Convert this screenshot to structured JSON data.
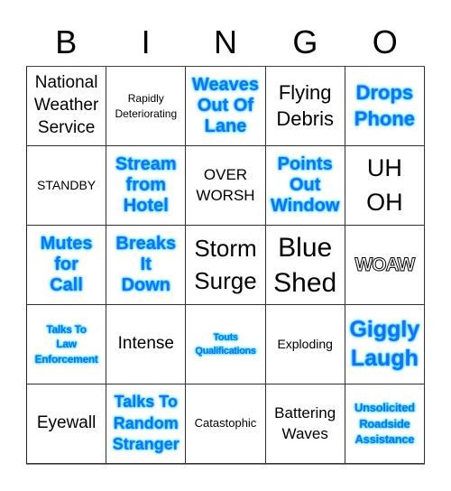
{
  "header": {
    "letters": [
      "B",
      "I",
      "N",
      "G",
      "O"
    ]
  },
  "colors": {
    "highlight_text": "#1e6bff",
    "highlight_glow": "#00d8ff",
    "normal_text": "#000000",
    "grid_line": "#333333"
  },
  "cells": [
    {
      "text": "National\nWeather\nService",
      "style": "normal"
    },
    {
      "text": "Rapidly\nDeteriorating",
      "style": "normal"
    },
    {
      "text": "Weaves\nOut Of\nLane",
      "style": "highlighted"
    },
    {
      "text": "Flying\nDebris",
      "style": "normal"
    },
    {
      "text": "Drops\nPhone",
      "style": "highlighted"
    },
    {
      "text": "STANDBY",
      "style": "normal"
    },
    {
      "text": "Stream\nfrom\nHotel",
      "style": "highlighted"
    },
    {
      "text": "OVER\nWORSH",
      "style": "normal"
    },
    {
      "text": "Points\nOut\nWindow",
      "style": "highlighted"
    },
    {
      "text": "UH\nOH",
      "style": "normal"
    },
    {
      "text": "Mutes\nfor\nCall",
      "style": "highlighted"
    },
    {
      "text": "Breaks\nIt\nDown",
      "style": "highlighted"
    },
    {
      "text": "Storm\nSurge",
      "style": "normal"
    },
    {
      "text": "Blue\nShed",
      "style": "normal"
    },
    {
      "text": "WOAW",
      "style": "outlined"
    },
    {
      "text": "Talks To\nLaw\nEnforcement",
      "style": "highlighted"
    },
    {
      "text": "Intense",
      "style": "normal"
    },
    {
      "text": "Touts\nQualifications",
      "style": "highlighted"
    },
    {
      "text": "Exploding",
      "style": "normal"
    },
    {
      "text": "Giggly\nLaugh",
      "style": "highlighted"
    },
    {
      "text": "Eyewall",
      "style": "normal"
    },
    {
      "text": "Talks To\nRandom\nStranger",
      "style": "highlighted"
    },
    {
      "text": "Catastophic",
      "style": "normal"
    },
    {
      "text": "Battering\nWaves",
      "style": "normal"
    },
    {
      "text": "Unsolicited\nRoadside\nAssistance",
      "style": "highlighted"
    }
  ]
}
